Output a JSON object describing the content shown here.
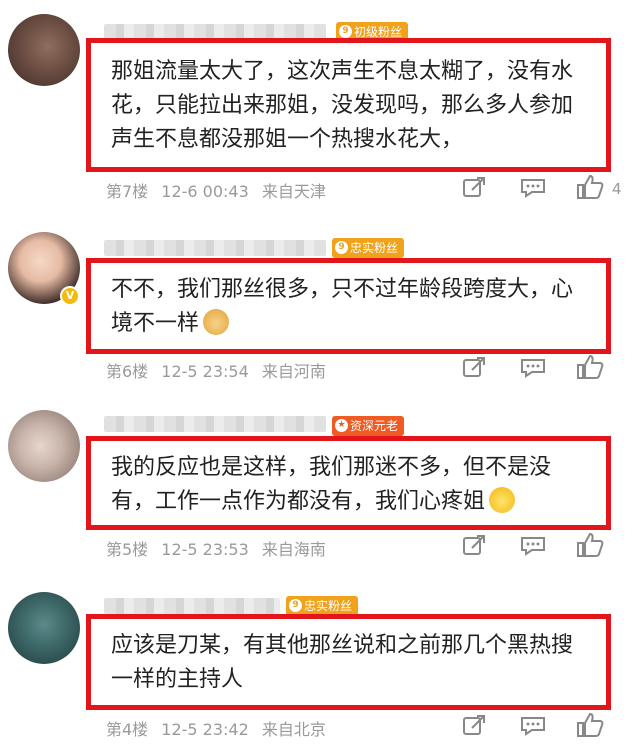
{
  "comments": [
    {
      "badge": "初级粉丝",
      "badge_color": "#f0a21a",
      "text": "那姐流量太大了，这次声生不息太糊了，没有水花，只能拉出来那姐，没发现吗，那么多人参加声生不息都没那姐一个热搜水花大，",
      "floor": "第7楼",
      "time": "12-6 00:43",
      "location": "来自天津",
      "likes": "4"
    },
    {
      "badge": "忠实粉丝",
      "badge_color": "#f0a21a",
      "text": "不不，我们那丝很多，只不过年龄段跨度大，心境不一样",
      "floor": "第6楼",
      "time": "12-5 23:54",
      "location": "来自河南",
      "likes": ""
    },
    {
      "badge": "资深元老",
      "badge_color": "#f05a23",
      "text": "我的反应也是这样，我们那迷不多，但不是没有，工作一点作为都没有，我们心疼姐",
      "floor": "第5楼",
      "time": "12-5 23:53",
      "location": "来自海南",
      "likes": ""
    },
    {
      "badge": "忠实粉丝",
      "badge_color": "#f0a21a",
      "text": "应该是刀某，有其他那丝说和之前那几个黑热搜一样的主持人",
      "floor": "第4楼",
      "time": "12-5 23:42",
      "location": "来自北京",
      "likes": ""
    }
  ],
  "icons": {
    "share": "share-icon",
    "comment": "comment-icon",
    "like": "like-icon",
    "verified": "verified-v-icon",
    "dog_emoji": "dog-emoji-icon",
    "cry_emoji": "crying-emoji-icon"
  },
  "accent": "#e2151b"
}
